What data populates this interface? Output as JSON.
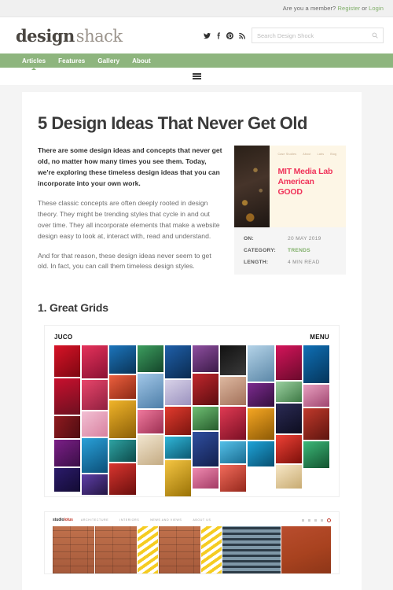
{
  "topbar": {
    "prompt": "Are you a member?",
    "register": "Register",
    "or": "or",
    "login": "Login"
  },
  "masthead": {
    "logo_primary": "design",
    "logo_secondary": "shack",
    "socials": [
      "twitter-icon",
      "facebook-icon",
      "pinterest-icon",
      "rss-icon"
    ],
    "search": {
      "placeholder": "Search Design Shock",
      "value": "",
      "icon": "search-icon"
    }
  },
  "nav": {
    "items": [
      {
        "label": "Articles",
        "active": true
      },
      {
        "label": "Features",
        "active": false
      },
      {
        "label": "Gallery",
        "active": false
      },
      {
        "label": "About",
        "active": false
      }
    ],
    "color": "#8eb57e",
    "hamburger": "hamburger-icon"
  },
  "article": {
    "title": "5 Design Ideas That Never Get Old",
    "paragraphs": [
      "There are some design ideas and concepts that never get old, no matter how many times you see them. Today, we're exploring these timeless design ideas that you can incorporate into your own work.",
      "These classic concepts are often deeply rooted in design theory. They might be trending styles that cycle in and out over time. They all incorporate elements that make a website design easy to look at, interact with, read and understand.",
      "And for that reason, these design ideas never seem to get old. In fact, you can call them timeless design styles."
    ],
    "section_heading": "1. Great Grids"
  },
  "aside": {
    "preview": {
      "mini_nav": [
        "Case Studies",
        "About",
        "Labs",
        "Blog"
      ],
      "headline_lines": [
        "MIT Media Lab",
        "American",
        "GOOD"
      ],
      "headline_color": "#f0335a",
      "background": "#fdf6e6"
    },
    "meta": [
      {
        "key": "ON:",
        "value": "20 MAY 2019",
        "accent": false
      },
      {
        "key": "CATEGORY:",
        "value": "TRENDS",
        "accent": true
      },
      {
        "key": "LENGTH:",
        "value": "4 MIN READ",
        "accent": false
      }
    ],
    "accent_color": "#7fae68"
  },
  "figure_juco": {
    "logo": "JUCO",
    "menu": "MENU",
    "tiles": [
      {
        "h": 40,
        "c": "linear-gradient(145deg,#d81327,#7e0712)"
      },
      {
        "h": 46,
        "c": "linear-gradient(160deg,#c8102e,#6d1020)"
      },
      {
        "h": 28,
        "c": "linear-gradient(120deg,#8f1a1f,#4f0d12)"
      },
      {
        "h": 34,
        "c": "linear-gradient(145deg,#7b1f87,#3b0f47)"
      },
      {
        "h": 30,
        "c": "linear-gradient(145deg,#2b1b6b,#130b33)"
      },
      {
        "h": 42,
        "c": "linear-gradient(150deg,#e5325b,#8a1133)"
      },
      {
        "h": 38,
        "c": "linear-gradient(145deg,#e8456b,#90203f)"
      },
      {
        "h": 32,
        "c": "linear-gradient(140deg,#f2c0d4,#d8819f)"
      },
      {
        "h": 44,
        "c": "linear-gradient(150deg,#29a0d8,#0c4f78)"
      },
      {
        "h": 26,
        "c": "linear-gradient(145deg,#5e3fa8,#241542)"
      },
      {
        "h": 36,
        "c": "linear-gradient(150deg,#1c75bc,#0a3457)"
      },
      {
        "h": 30,
        "c": "linear-gradient(145deg,#ec5f3e,#8c2a15)"
      },
      {
        "h": 48,
        "c": "linear-gradient(150deg,#f0b429,#8c5f08)"
      },
      {
        "h": 28,
        "c": "linear-gradient(140deg,#2ea3a3,#0d4a4a)"
      },
      {
        "h": 40,
        "c": "linear-gradient(150deg,#d9352f,#6b0f0d)"
      },
      {
        "h": 34,
        "c": "linear-gradient(145deg,#3d9e5f,#14452a)"
      },
      {
        "h": 44,
        "c": "linear-gradient(150deg,#a2c7e8,#4d7ea8)"
      },
      {
        "h": 30,
        "c": "linear-gradient(140deg,#f07a9e,#9c2f52)"
      },
      {
        "h": 38,
        "c": "linear-gradient(150deg,#f2e6d0,#c4ab83)"
      },
      {
        "h": 42,
        "c": "linear-gradient(145deg,#1f5fa9,#0a2b50)"
      },
      {
        "h": 32,
        "c": "linear-gradient(150deg,#d8d2e8,#9b92bf)"
      },
      {
        "h": 36,
        "c": "linear-gradient(145deg,#e23b2e,#7b150f)"
      },
      {
        "h": 28,
        "c": "linear-gradient(150deg,#30b6d8,#0c5a73)"
      },
      {
        "h": 46,
        "c": "linear-gradient(145deg,#f4c542,#9a7206)"
      },
      {
        "h": 34,
        "c": "linear-gradient(150deg,#8e4fa0,#3c1b48)"
      },
      {
        "h": 40,
        "c": "linear-gradient(145deg,#c1272d,#5c0d10)"
      },
      {
        "h": 30,
        "c": "linear-gradient(150deg,#6fbf73,#265c2c)"
      },
      {
        "h": 44,
        "c": "linear-gradient(145deg,#2f4fa0,#131f4d)"
      },
      {
        "h": 26,
        "c": "linear-gradient(150deg,#ef8ab0,#a33b65)"
      },
      {
        "h": 38,
        "c": "linear-gradient(145deg,#111111,#3a3a3a)"
      },
      {
        "h": 36,
        "c": "linear-gradient(150deg,#ddb8a0,#a3715a)"
      },
      {
        "h": 42,
        "c": "linear-gradient(145deg,#e03a53,#7a0f24)"
      },
      {
        "h": 28,
        "c": "linear-gradient(150deg,#54c0e8,#1a6c91)"
      },
      {
        "h": 34,
        "c": "linear-gradient(145deg,#f26b5b,#95281c)"
      },
      {
        "h": 46,
        "c": "linear-gradient(150deg,#b4d3e8,#5c88a8)"
      },
      {
        "h": 30,
        "c": "linear-gradient(145deg,#7c2b8f,#330f3d)"
      },
      {
        "h": 40,
        "c": "linear-gradient(150deg,#f5a623,#8d5a05)"
      },
      {
        "h": 32,
        "c": "linear-gradient(145deg,#1fa3d8,#084f70)"
      },
      {
        "h": 44,
        "c": "linear-gradient(150deg,#d4145a,#6b0a2c)"
      },
      {
        "h": 26,
        "c": "linear-gradient(145deg,#9bd0a0,#3f7a46)"
      },
      {
        "h": 38,
        "c": "linear-gradient(150deg,#2b2b55,#0d0d1f)"
      },
      {
        "h": 36,
        "c": "linear-gradient(145deg,#ef4136,#7d100a)"
      },
      {
        "h": 30,
        "c": "linear-gradient(150deg,#f7e7c6,#c8ab72)"
      },
      {
        "h": 48,
        "c": "linear-gradient(145deg,#0f6fb5,#05355a)"
      },
      {
        "h": 28,
        "c": "linear-gradient(150deg,#e8a0c0,#a04670)"
      },
      {
        "h": 40,
        "c": "linear-gradient(145deg,#c0392b,#5e150f)"
      },
      {
        "h": 34,
        "c": "linear-gradient(150deg,#3cb878,#13532f)"
      },
      {
        "h": 42,
        "c": "linear-gradient(145deg,#5b6fd8,#1e2760)"
      },
      {
        "h": 30,
        "c": "linear-gradient(150deg,#f9a8c0,#b24a70)"
      },
      {
        "h": 38,
        "c": "linear-gradient(145deg,#2e86c1,#0d3c5c)"
      },
      {
        "h": 32,
        "c": "linear-gradient(150deg,#e6762f,#8a3c0c)"
      },
      {
        "h": 44,
        "c": "linear-gradient(145deg,#7d2f8f,#34103d)"
      },
      {
        "h": 28,
        "c": "linear-gradient(150deg,#88c9e8,#3a7794)"
      },
      {
        "h": 36,
        "c": "linear-gradient(145deg,#d62828,#6a0f0f)"
      },
      {
        "h": 40,
        "c": "linear-gradient(150deg,#f4d35e,#97801a)"
      },
      {
        "h": 30,
        "c": "linear-gradient(145deg,#1b4f9c,#091f43)"
      },
      {
        "h": 46,
        "c": "linear-gradient(150deg,#ee6c9c,#9c2a56)"
      },
      {
        "h": 34,
        "c": "linear-gradient(145deg,#27ae60,#0d4a27)"
      },
      {
        "h": 26,
        "c": "linear-gradient(150deg,#bfd7e8,#6d90a8)"
      },
      {
        "h": 42,
        "c": "linear-gradient(145deg,#b03060,#4d1029)"
      }
    ]
  },
  "figure_studio": {
    "logo_prefix": "studio",
    "logo_suffix": "lotus",
    "nav": [
      "ARCHITECTURE",
      "INTERIORS",
      "NEWS AND VIEWS",
      "ABOUT US"
    ],
    "icons": [
      "facebook-icon",
      "twitter-icon",
      "linkedin-icon",
      "instagram-icon",
      "search-icon"
    ]
  }
}
